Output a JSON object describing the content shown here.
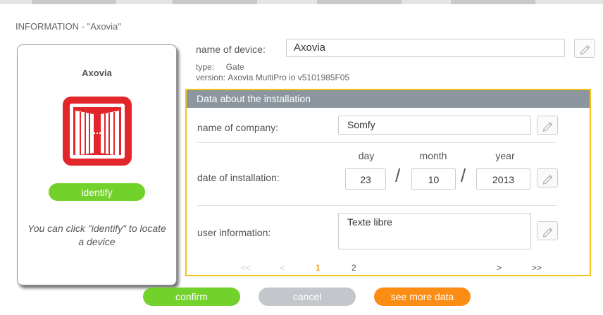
{
  "header": {
    "title": "INFORMATION - \"Axovia\""
  },
  "device_card": {
    "name": "Axovia",
    "icon": "gate-icon",
    "identify_label": "identify",
    "help_text": "You can click \"identify\" to locate a device"
  },
  "device": {
    "name_label": "name of device:",
    "name_value": "Axovia",
    "type_label": "type:",
    "type_value": "Gate",
    "version_label": "version:",
    "version_value": "Axovia MultiPro io v5101985F05"
  },
  "installation": {
    "title": "Data about the installation",
    "company_label": "name of company:",
    "company_value": "Somfy",
    "date_label": "date of installation:",
    "day_label": "day",
    "month_label": "month",
    "year_label": "year",
    "day_value": "23",
    "month_value": "10",
    "year_value": "2013",
    "user_info_label": "user information:",
    "user_info_value": "Texte libre",
    "pagination": {
      "first": "<<",
      "prev": "<",
      "pages": [
        "1",
        "2"
      ],
      "current": "1",
      "next": ">",
      "last": ">>"
    }
  },
  "actions": {
    "confirm": "confirm",
    "cancel": "cancel",
    "see_more": "see more data"
  },
  "colors": {
    "accent_green": "#73d12b",
    "accent_orange": "#fb8c14",
    "panel_border": "#f2c21b",
    "panel_header": "#8b969e",
    "device_red": "#e3262b"
  }
}
